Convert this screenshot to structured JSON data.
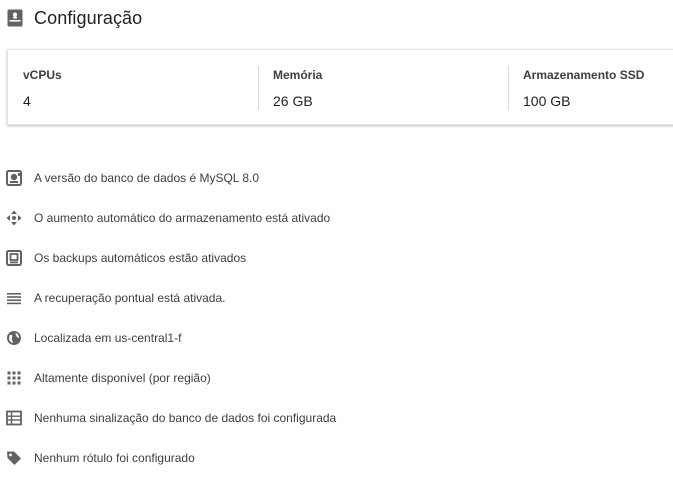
{
  "header": {
    "icon": "server-icon",
    "title": "Configuração"
  },
  "config": {
    "stats": [
      {
        "label": "vCPUs",
        "value": "4"
      },
      {
        "label": "Memória",
        "value": "26 GB"
      },
      {
        "label": "Armazenamento SSD",
        "value": "100 GB"
      }
    ]
  },
  "features": [
    {
      "icon": "database-version-icon",
      "text": "A versão do banco de dados é MySQL 8.0"
    },
    {
      "icon": "auto-storage-increase-icon",
      "text": "O aumento automático do armazenamento está ativado"
    },
    {
      "icon": "backup-icon",
      "text": "Os backups automáticos estão ativados"
    },
    {
      "icon": "point-in-time-recovery-icon",
      "text": "A recuperação pontual está ativada."
    },
    {
      "icon": "globe-icon",
      "text": "Localizada em us-central1-f"
    },
    {
      "icon": "grid-icon",
      "text": "Altamente disponível (por região)"
    },
    {
      "icon": "flags-list-icon",
      "text": "Nenhuma sinalização do banco de dados foi configurada"
    },
    {
      "icon": "label-tag-icon",
      "text": "Nenhum rótulo foi configurado"
    }
  ],
  "colors": {
    "icon": "#5f6368",
    "text": "#3c4043",
    "title": "#202124",
    "divider": "#dadce0"
  }
}
